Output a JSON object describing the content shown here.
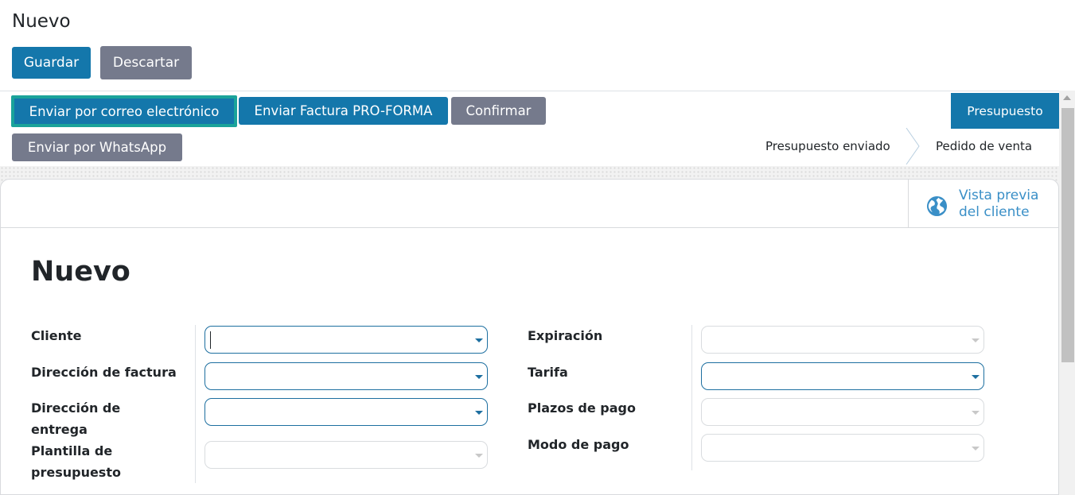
{
  "control_panel": {
    "title": "Nuevo",
    "save_label": "Guardar",
    "discard_label": "Descartar"
  },
  "statusbar": {
    "buttons": {
      "email": "Enviar por correo electrónico",
      "proforma": "Enviar Factura PRO-FORMA",
      "confirm": "Confirmar",
      "whatsapp": "Enviar por WhatsApp"
    },
    "stages": {
      "current": "Presupuesto",
      "sent": "Presupuesto enviado",
      "order": "Pedido de venta"
    }
  },
  "button_box": {
    "preview_line1": "Vista previa",
    "preview_line2": "del cliente",
    "preview_icon": "globe-icon"
  },
  "form": {
    "record_name": "Nuevo",
    "left_labels": {
      "customer": "Cliente",
      "invoice_address": "Dirección de factura",
      "delivery_address_1": "Dirección de",
      "delivery_address_2": "entrega",
      "template_1": "Plantilla de",
      "template_2": "presupuesto"
    },
    "right_labels": {
      "expiration": "Expiración",
      "pricelist": "Tarifa",
      "payment_terms": "Plazos de pago",
      "payment_mode": "Modo de pago"
    }
  },
  "colors": {
    "primary": "#1477ab",
    "secondary": "#757a8c",
    "focus_outline": "#1aa39a",
    "link": "#3a8fc7"
  }
}
